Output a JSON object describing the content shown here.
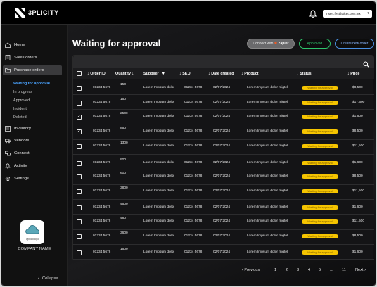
{
  "brand": {
    "name": "3PLICITY"
  },
  "account": {
    "email": "Insert.fes@alcet.com.mx"
  },
  "sidebar": {
    "items": [
      {
        "label": "Home",
        "icon": "home-icon"
      },
      {
        "label": "Sales orders",
        "icon": "document-icon"
      },
      {
        "label": "Purchase orders",
        "icon": "folder-icon"
      },
      {
        "label": "Inventory",
        "icon": "list-icon"
      },
      {
        "label": "Vendors",
        "icon": "truck-icon"
      },
      {
        "label": "Connect",
        "icon": "link-icon"
      },
      {
        "label": "Activity",
        "icon": "bell-icon"
      },
      {
        "label": "Settings",
        "icon": "gear-icon"
      }
    ],
    "subitems": [
      "Waiting for approval",
      "In progress",
      "Approved",
      "Incident",
      "Deleted"
    ],
    "upload_label": "Upload logo",
    "company": "COMPANY NAME",
    "collapse": "Collapse"
  },
  "main": {
    "title": "Waiting for approval",
    "zap_prefix": "Connect with",
    "zap_brand": "Zapier",
    "approved_btn": "Approved",
    "new_order_btn": "Create new order"
  },
  "table": {
    "headers": [
      "Order ID",
      "Quantity",
      "Supplier",
      "SKU",
      "Date created",
      "Product",
      "Status",
      "Price"
    ],
    "rows": [
      {
        "checked": false,
        "order": "01234 5678",
        "qty": "150",
        "supplier": "Lorem Impsum dolor",
        "sku": "01234 5678",
        "date": "02/07/2024",
        "product": "Lorem Impsum dolor migtel",
        "status": "Waiting for approval",
        "price": "$8,500"
      },
      {
        "checked": false,
        "order": "01234 5678",
        "qty": "150",
        "supplier": "Lorem Impsum dolor",
        "sku": "01234 5678",
        "date": "02/07/2024",
        "product": "Lorem Impsum dolor migtel",
        "status": "Waiting for approval",
        "price": "$17,500"
      },
      {
        "checked": true,
        "order": "01234 5678",
        "qty": "2500",
        "supplier": "Lorem Impsum dolor",
        "sku": "01234 5678",
        "date": "02/07/2024",
        "product": "Lorem Impsum dolor migtel",
        "status": "Waiting for approval",
        "price": "$1,600"
      },
      {
        "checked": true,
        "order": "01234 5678",
        "qty": "850",
        "supplier": "Lorem Impsum dolor",
        "sku": "01234 5678",
        "date": "02/07/2024",
        "product": "Lorem Impsum dolor migtel",
        "status": "Waiting for approval",
        "price": "$8,500"
      },
      {
        "checked": false,
        "order": "01234 5678",
        "qty": "1300",
        "supplier": "Lorem Impsum dolor",
        "sku": "01234 5678",
        "date": "02/07/2024",
        "product": "Lorem Impsum dolor migtel",
        "status": "Waiting for approval",
        "price": "$11,500"
      },
      {
        "checked": false,
        "order": "01234 5678",
        "qty": "900",
        "supplier": "Lorem Impsum dolor",
        "sku": "01234 5678",
        "date": "02/07/2024",
        "product": "Lorem Impsum dolor migtel",
        "status": "Waiting for approval",
        "price": "$1,600"
      },
      {
        "checked": false,
        "order": "01234 5678",
        "qty": "600",
        "supplier": "Lorem Impsum dolor",
        "sku": "01234 5678",
        "date": "02/07/2024",
        "product": "Lorem Impsum dolor migtel",
        "status": "Waiting for approval",
        "price": "$8,500"
      },
      {
        "checked": false,
        "order": "01234 5678",
        "qty": "3800",
        "supplier": "Lorem Impsum dolor",
        "sku": "01234 5678",
        "date": "02/07/2024",
        "product": "Lorem Impsum dolor migtel",
        "status": "Waiting for approval",
        "price": "$11,500"
      },
      {
        "checked": false,
        "order": "01234 5678",
        "qty": "4500",
        "supplier": "Lorem Impsum dolor",
        "sku": "01234 5678",
        "date": "02/07/2024",
        "product": "Lorem Impsum dolor migtel",
        "status": "Waiting for approval",
        "price": "$1,600"
      },
      {
        "checked": false,
        "order": "01234 5678",
        "qty": "480",
        "supplier": "Lorem Impsum dolor",
        "sku": "01234 5678",
        "date": "02/07/2024",
        "product": "Lorem Impsum dolor migtel",
        "status": "Waiting for approval",
        "price": "$11,500"
      },
      {
        "checked": false,
        "order": "01234 5678",
        "qty": "3600",
        "supplier": "Lorem Impsum dolor",
        "sku": "01234 5678",
        "date": "02/07/2024",
        "product": "Lorem Impsum dolor migtel",
        "status": "Waiting for approval",
        "price": "$8,500"
      },
      {
        "checked": false,
        "order": "01234 5678",
        "qty": "1500",
        "supplier": "Lorem Impsum dolor",
        "sku": "01234 5678",
        "date": "02/07/2024",
        "product": "Lorem Impsum dolor migtel",
        "status": "Waiting for approval",
        "price": "$1,600"
      }
    ]
  },
  "pagination": {
    "previous": "Previous",
    "pages": [
      "1",
      "2",
      "3",
      "4",
      "5",
      "...",
      "11"
    ],
    "next": "Next"
  },
  "colors": {
    "status": "#f5c400",
    "approved": "#2ec46b",
    "accent": "#4a90e2"
  }
}
